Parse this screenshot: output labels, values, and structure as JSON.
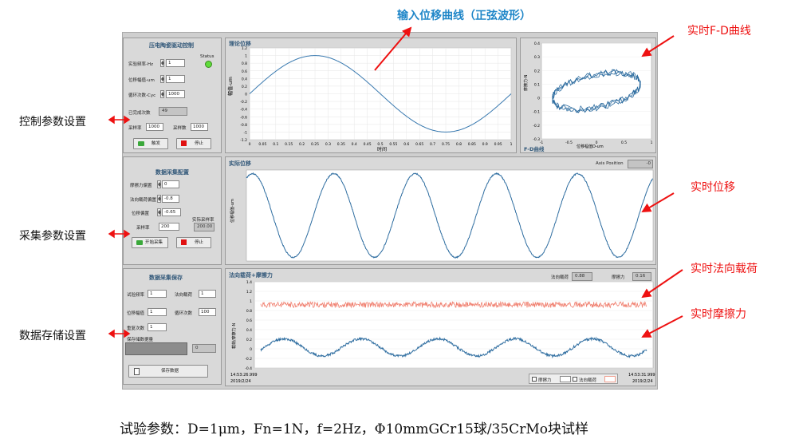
{
  "annotations": {
    "input_curve": "输入位移曲线（正弦波形）",
    "fd_curve": "实时F-D曲线",
    "control_params": "控制参数设置",
    "realtime_disp": "实时位移",
    "acq_params": "采集参数设置",
    "normal_load": "实时法向载荷",
    "friction": "实时摩擦力",
    "storage": "数据存储设置"
  },
  "caption": "试验参数：D=1μm，Fn=1N，f=2Hz，Φ10mmGCr15球/35CrMo块试样",
  "control": {
    "title": "压电陶瓷驱动控制",
    "status_label": "Status",
    "freq_label": "实验频率-Hz",
    "freq_value": "1",
    "amp_label": "位移幅值-um",
    "amp_value": "1",
    "cycles_label": "循环次数-Cyc",
    "cycles_value": "1000",
    "done_label": "已完成次数",
    "done_value": "49",
    "rate_label": "采样率",
    "rate_value": "1000",
    "count_label": "采样数",
    "count_value": "1000",
    "trigger_label": "触发",
    "stop_label": "停止"
  },
  "acq": {
    "title": "数据采集配置",
    "friction_gain_label": "摩擦力偏置",
    "friction_gain_value": "0",
    "normal_gain_label": "法向载荷偏置",
    "normal_gain_value": "-0.8",
    "disp_gain_label": "位移偏置",
    "disp_gain_value": "-0.65",
    "rate_label": "采样率",
    "rate_value": "200",
    "actual_rate_label": "实际采样率",
    "actual_rate_value": "200.00",
    "start_label": "开始采集",
    "stop_label": "停止"
  },
  "save": {
    "title": "数据采集保存",
    "f1_label": "试验频率",
    "f1_value": "1",
    "f2_label": "法向载荷",
    "f2_value": "1",
    "f3_label": "位移幅值",
    "f3_value": "1",
    "f4_label": "循环次数",
    "f4_value": "100",
    "f5_label": "重复次数",
    "f5_value": "1",
    "progress_label": "保存储数据量",
    "progress_value": "0",
    "save_label": "保存数据"
  },
  "graph_theory": {
    "title": "理论位移",
    "ylabel": "幅值-um",
    "xlabel": "时间",
    "yticks": [
      "1.2",
      "1",
      "0.8",
      "0.6",
      "0.4",
      "0.2",
      "0",
      "-0.2",
      "-0.4",
      "-0.6",
      "-0.8",
      "-1",
      "-1.2"
    ],
    "xticks": [
      "0",
      "0.05",
      "0.1",
      "0.15",
      "0.2",
      "0.25",
      "0.3",
      "0.35",
      "0.4",
      "0.45",
      "0.5",
      "0.55",
      "0.6",
      "0.65",
      "0.7",
      "0.75",
      "0.8",
      "0.85",
      "0.9",
      "0.95",
      "1"
    ]
  },
  "graph_fd": {
    "ylabel": "摩擦力-N",
    "xlabel": "位移幅值D-um",
    "footer": "F-D曲线",
    "yticks": [
      "0.4",
      "0.3",
      "0.2",
      "0.1",
      "0",
      "-0.1",
      "-0.2",
      "-0.3"
    ],
    "xticks": [
      "-1",
      "-0.5",
      "0",
      "0.5",
      "1"
    ]
  },
  "graph_disp": {
    "title": "实际位移",
    "ylabel": "位移幅值-um",
    "axis_pos_label": "Axis Position",
    "axis_pos_value": "-0"
  },
  "graph_force": {
    "title": "法向载荷+摩擦力",
    "ylabel": "载荷/摩擦力-N",
    "normal_label": "法向载荷",
    "normal_value": "0.88",
    "friction_label": "摩擦力",
    "friction_value": "0.16",
    "yticks": [
      "1.4",
      "1.2",
      "1",
      "0.8",
      "0.6",
      "0.4",
      "0.2",
      "0",
      "-0.2",
      "-0.4"
    ],
    "t_start": "14:53:26.999",
    "d_start": "2019/2/24",
    "t_end": "14:53:31.999",
    "d_end": "2019/2/24",
    "legend_friction": "摩擦力",
    "legend_normal": "法向载荷"
  },
  "colors": {
    "annotation": "#ee1111",
    "curve": "#2e6da0",
    "normal_curve": "#f08070",
    "panel": "#d9d9d9",
    "title_blue": "#33597a"
  },
  "chart_data": [
    {
      "type": "line",
      "title": "理论位移",
      "xlabel": "时间",
      "ylabel": "幅值-um",
      "xlim": [
        0,
        1
      ],
      "ylim": [
        -1.2,
        1.2
      ],
      "series": [
        {
          "function": "sin(2*pi*x)",
          "amplitude": 1
        }
      ]
    },
    {
      "type": "line",
      "title": "实际位移",
      "ylabel": "位移幅值-um",
      "series": [
        {
          "periods": 5,
          "amplitude": 1
        }
      ]
    },
    {
      "type": "line",
      "title": "法向载荷+摩擦力",
      "ylabel": "载荷/摩擦力-N",
      "ylim": [
        -0.4,
        1.4
      ],
      "series": [
        {
          "name": "法向载荷",
          "mean": 0.92
        },
        {
          "name": "摩擦力",
          "mean": 0.0,
          "amplitude": 0.2,
          "periods": 5
        }
      ]
    },
    {
      "type": "scatter",
      "xlabel": "位移幅值D-um",
      "ylabel": "摩擦力-N",
      "xlim": [
        -1,
        1
      ],
      "ylim": [
        -0.3,
        0.4
      ]
    }
  ]
}
